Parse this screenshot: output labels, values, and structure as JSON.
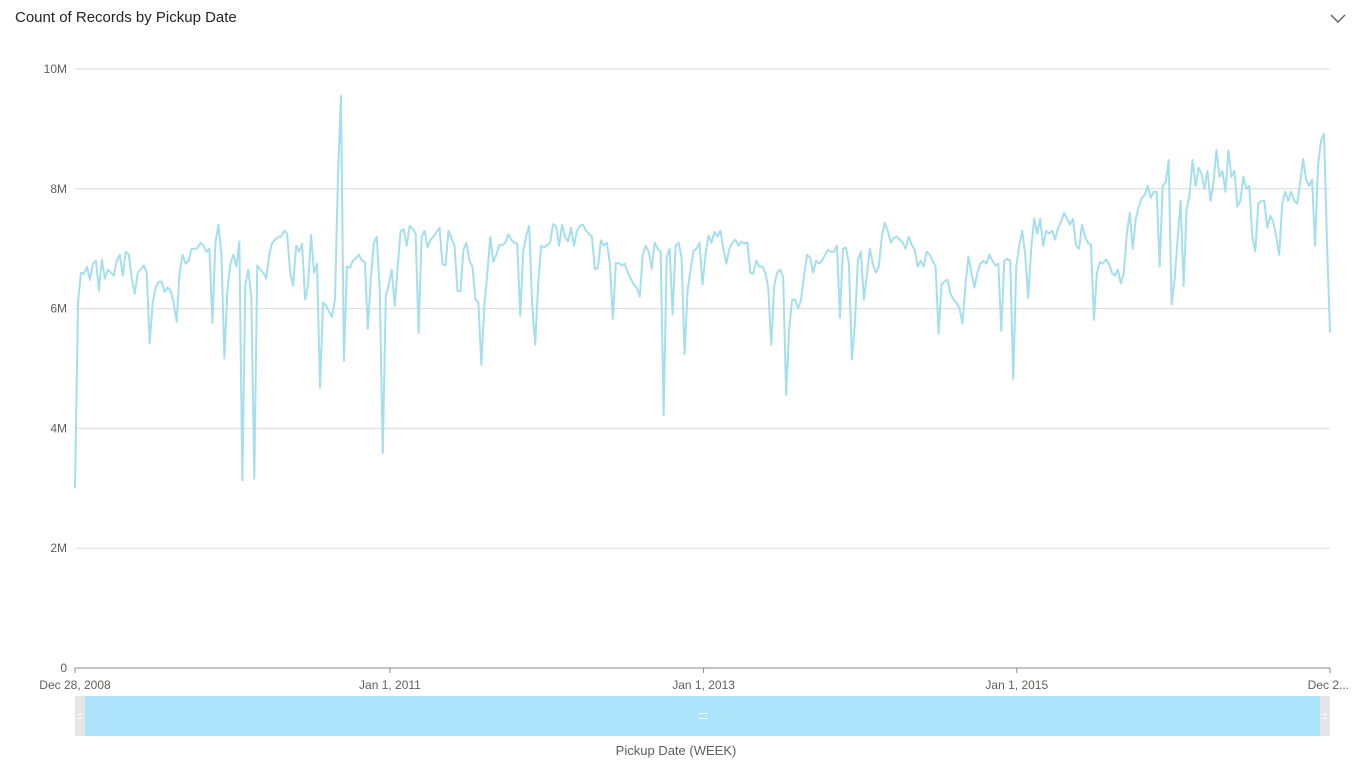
{
  "title": "Count of Records by Pickup Date",
  "collapse_icon": "chevron-down-icon",
  "colors": {
    "line": "#a5dfec",
    "grid": "#d9d9d9",
    "axis": "#8a8886",
    "scroll_thumb": "#aee4fb",
    "scroll_track": "#e6e6e6"
  },
  "chart_data": {
    "type": "line",
    "title": "Count of Records by Pickup Date",
    "xlabel": "Pickup Date (WEEK)",
    "ylabel": "",
    "ylim": [
      0,
      10000000
    ],
    "yticks": [
      0,
      2000000,
      4000000,
      6000000,
      8000000,
      10000000
    ],
    "ytick_labels": [
      "0",
      "2M",
      "4M",
      "6M",
      "8M",
      "10M"
    ],
    "xticks": [
      "2008-12-28",
      "2011-01-01",
      "2013-01-01",
      "2015-01-01",
      "2016-12-31"
    ],
    "xtick_labels": [
      "Dec 28, 2008",
      "Jan 1, 2011",
      "Jan 1, 2013",
      "Jan 1, 2015",
      "Dec 2..."
    ],
    "grid": true,
    "legend": "none",
    "x_start": "2008-12-28",
    "x_end": "2016-12-31",
    "x_interval": "week",
    "y": [
      3000000,
      6100000,
      6600000,
      6580000,
      6700000,
      6480000,
      6750000,
      6800000,
      6300000,
      6820000,
      6500000,
      6650000,
      6600000,
      6550000,
      6800000,
      6900000,
      6550000,
      6950000,
      6900000,
      6500000,
      6250000,
      6600000,
      6650000,
      6720000,
      6600000,
      5420000,
      6100000,
      6350000,
      6450000,
      6450000,
      6280000,
      6350000,
      6300000,
      6100000,
      5780000,
      6600000,
      6900000,
      6750000,
      6800000,
      7000000,
      7000000,
      7010000,
      7100000,
      7050000,
      6950000,
      7000000,
      5760000,
      7100000,
      7400000,
      6900000,
      5170000,
      6300000,
      6750000,
      6900000,
      6700000,
      7120000,
      3130000,
      6400000,
      6650000,
      6200000,
      3160000,
      6720000,
      6650000,
      6600000,
      6500000,
      6900000,
      7100000,
      7150000,
      7200000,
      7200000,
      7300000,
      7250000,
      6600000,
      6380000,
      7050000,
      6950000,
      7080000,
      6150000,
      6400000,
      7230000,
      6600000,
      6750000,
      4680000,
      6100000,
      6050000,
      5950000,
      5860000,
      6150000,
      8200000,
      9550000,
      5130000,
      6700000,
      6680000,
      6800000,
      6840000,
      6900000,
      6800000,
      6780000,
      5660000,
      6500000,
      7100000,
      7200000,
      6300000,
      3590000,
      6200000,
      6400000,
      6650000,
      6050000,
      6700000,
      7300000,
      7320000,
      7050000,
      7380000,
      7330000,
      7250000,
      5590000,
      7200000,
      7300000,
      7020000,
      7150000,
      7200000,
      7280000,
      7350000,
      6740000,
      6720000,
      7300000,
      7170000,
      7050000,
      6300000,
      6290000,
      6980000,
      7100000,
      6800000,
      6700000,
      6160000,
      6100000,
      5060000,
      6050000,
      6600000,
      7200000,
      6780000,
      6900000,
      7060000,
      7060000,
      7100000,
      7240000,
      7150000,
      7100000,
      7080000,
      5880000,
      6950000,
      7220000,
      7380000,
      6050000,
      5400000,
      6400000,
      7050000,
      7020000,
      7060000,
      7100000,
      7410000,
      7380000,
      7050000,
      7400000,
      7200000,
      7120000,
      7350000,
      7050000,
      7300000,
      7380000,
      7400000,
      7300000,
      7250000,
      7200000,
      6660000,
      6680000,
      7140000,
      7050000,
      7100000,
      6750000,
      5830000,
      6760000,
      6760000,
      6720000,
      6750000,
      6600000,
      6500000,
      6400000,
      6350000,
      6200000,
      6900000,
      7050000,
      6950000,
      6660000,
      7100000,
      7000000,
      6950000,
      4220000,
      6850000,
      7000000,
      5900000,
      7050000,
      7100000,
      6850000,
      5240000,
      6300000,
      6650000,
      6960000,
      7000000,
      7100000,
      6400000,
      6900000,
      7220000,
      7100000,
      7280000,
      7200000,
      7300000,
      7000000,
      6750000,
      7000000,
      7100000,
      7150000,
      7050000,
      7120000,
      7080000,
      7110000,
      6600000,
      6580000,
      6800000,
      6700000,
      6700000,
      6600000,
      6350000,
      5400000,
      6380000,
      6600000,
      6650000,
      6520000,
      4560000,
      5650000,
      6150000,
      6150000,
      6000000,
      6150000,
      6560000,
      6900000,
      6850000,
      6600000,
      6800000,
      6750000,
      6800000,
      6900000,
      6980000,
      6950000,
      6950000,
      7050000,
      5850000,
      7000000,
      7020000,
      6750000,
      5150000,
      5750000,
      6800000,
      6950000,
      6150000,
      6550000,
      7000000,
      6750000,
      6600000,
      6700000,
      7200000,
      7430000,
      7300000,
      7100000,
      7180000,
      7200000,
      7150000,
      7100000,
      7000000,
      7200000,
      7070000,
      6980000,
      6700000,
      6800000,
      6700000,
      6950000,
      6900000,
      6800000,
      6700000,
      5580000,
      6400000,
      6450000,
      6480000,
      6250000,
      6150000,
      6100000,
      6000000,
      5750000,
      6400000,
      6870000,
      6600000,
      6350000,
      6600000,
      6750000,
      6800000,
      6750000,
      6900000,
      6800000,
      6720000,
      6750000,
      5630000,
      6800000,
      6830000,
      6800000,
      4820000,
      6700000,
      7050000,
      7300000,
      6900000,
      6180000,
      7000000,
      7500000,
      7250000,
      7500000,
      7050000,
      7300000,
      7250000,
      7300000,
      7150000,
      7350000,
      7450000,
      7600000,
      7500000,
      7400000,
      7500000,
      7050000,
      7000000,
      7400000,
      7200000,
      7100000,
      7070000,
      5810000,
      6600000,
      6780000,
      6750000,
      6820000,
      6750000,
      6600000,
      6550000,
      6650000,
      6420000,
      6600000,
      7250000,
      7600000,
      7000000,
      7500000,
      7700000,
      7850000,
      7900000,
      8050000,
      7850000,
      7950000,
      7950000,
      6700000,
      8050000,
      8100000,
      8480000,
      6070000,
      6500000,
      7150000,
      7800000,
      6380000,
      7650000,
      7900000,
      8480000,
      8050000,
      8350000,
      8250000,
      8000000,
      8300000,
      7800000,
      8100000,
      8650000,
      8200000,
      8300000,
      7950000,
      8640000,
      8200000,
      8300000,
      7700000,
      7800000,
      8200000,
      8000000,
      8050000,
      7200000,
      6950000,
      7750000,
      7800000,
      7800000,
      7350000,
      7550000,
      7450000,
      7200000,
      6900000,
      7750000,
      7950000,
      7800000,
      7950000,
      7800000,
      7750000,
      8100000,
      8500000,
      8150000,
      8050000,
      8150000,
      7050000,
      8400000,
      8800000,
      8920000,
      7100000,
      5600000
    ]
  },
  "scrollbar": {
    "thumb_grip_icon": "grip-icon",
    "start_fraction": 0.0,
    "end_fraction": 1.0
  }
}
